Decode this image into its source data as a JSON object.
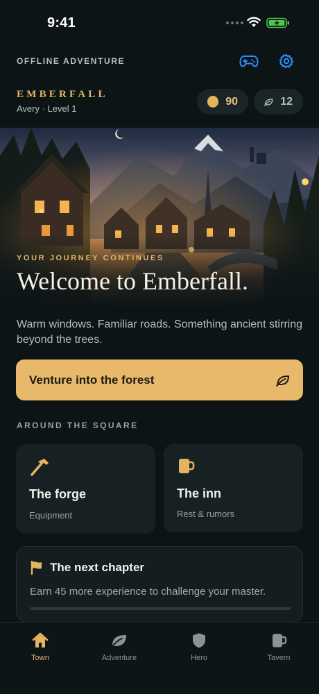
{
  "status_bar": {
    "time": "9:41"
  },
  "topbar": {
    "label": "OFFLINE ADVENTURE",
    "icons": [
      "gamepad-icon",
      "gear-icon"
    ]
  },
  "header": {
    "title": "EMBERFALL",
    "player": "Avery · Level 1",
    "gold": "90",
    "leaves": "12"
  },
  "hero": {
    "eyebrow": "YOUR JOURNEY CONTINUES",
    "title": "Welcome to Emberfall."
  },
  "tagline": "Warm windows. Familiar roads. Something ancient stirring beyond the trees.",
  "cta": {
    "label": "Venture into the forest",
    "icon": "leaf-icon"
  },
  "section": {
    "label": "AROUND THE SQUARE"
  },
  "cards": [
    {
      "title": "The forge",
      "subtitle": "Equipment",
      "icon": "hammer-icon"
    },
    {
      "title": "The inn",
      "subtitle": "Rest & rumors",
      "icon": "mug-icon"
    }
  ],
  "chapter": {
    "title": "The next chapter",
    "text": "Earn 45 more experience to challenge your master.",
    "progress": 0
  },
  "tabs": [
    {
      "label": "Town",
      "icon": "house-icon",
      "active": true
    },
    {
      "label": "Adventure",
      "icon": "leaf-icon",
      "active": false
    },
    {
      "label": "Hero",
      "icon": "shield-icon",
      "active": false
    },
    {
      "label": "Tavern",
      "icon": "mug-icon",
      "active": false
    }
  ],
  "colors": {
    "background": "#0d1416",
    "accent": "#e6b45f",
    "link_blue": "#2f8cff",
    "card": "#172022",
    "leaf_green": "#a9c8b4"
  }
}
